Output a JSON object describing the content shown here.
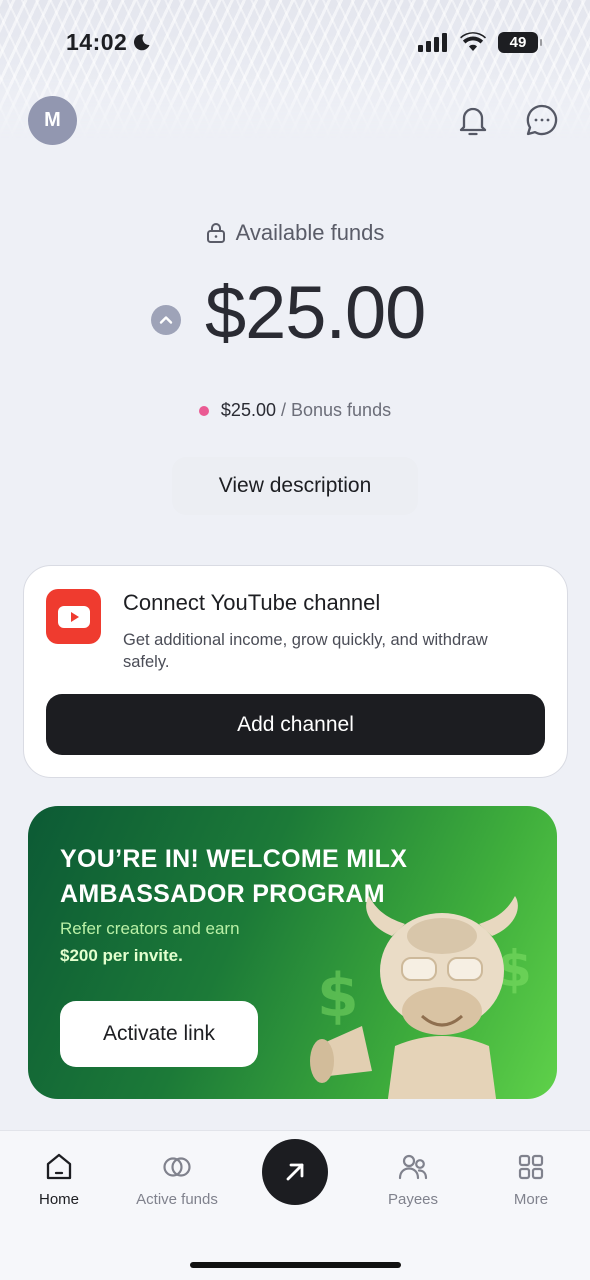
{
  "status_bar": {
    "time": "14:02",
    "battery": "49"
  },
  "header": {
    "avatar_initial": "M"
  },
  "balance": {
    "label": "Available funds",
    "amount": "$25.00",
    "bonus_amount": "$25.00",
    "bonus_label": "/ Bonus funds",
    "view_description": "View description"
  },
  "youtube_card": {
    "title": "Connect YouTube channel",
    "description": "Get additional income, grow quickly, and withdraw safely.",
    "button": "Add channel"
  },
  "promo": {
    "title": "YOU’RE IN! WELCOME MILX AMBASSADOR PROGRAM",
    "subtitle": "Refer creators and earn",
    "highlight": "$200 per invite.",
    "button": "Activate link"
  },
  "tabbar": {
    "items": [
      {
        "label": "Home",
        "icon": "home-icon",
        "active": true
      },
      {
        "label": "Active funds",
        "icon": "active-funds-icon",
        "active": false
      },
      {
        "label": "Payees",
        "icon": "payees-icon",
        "active": false
      },
      {
        "label": "More",
        "icon": "grid-icon",
        "active": false
      }
    ],
    "fab_icon": "arrow-up-right-icon"
  }
}
